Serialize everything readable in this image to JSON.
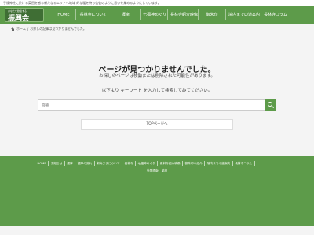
{
  "topbar": {
    "text": "子规神社に於ける菜田を感る新たなるエリアへ地域 的な暖を持ち信徒のように思いを集めるようにしています。"
  },
  "header": {
    "logo_sub": "あなたを歓迎する",
    "logo_main": "振興会"
  },
  "nav": [
    "HOME",
    "長林寺について",
    "護摩",
    "七福神めぐり",
    "長林寺紹介映像",
    "御朱印",
    "境内までの道案内",
    "長林寺コラム"
  ],
  "breadcrumb": {
    "home": "ホーム",
    "current": "お探しの記事は見つかりませんでした。"
  },
  "notfound": {
    "title": "ページが見つかりませんでした。",
    "message": "お探しのページは移動または削除された可能性があります。",
    "hint": "以下より キーワード を入力して検索してみてください。"
  },
  "search": {
    "placeholder": "検索"
  },
  "top_link": "TOPページへ",
  "footer": {
    "nav": [
      "HOME",
      "お知らせ",
      "護摩",
      "護摩の流れ",
      "和尚さまについて",
      "長林寺",
      "七福神めぐり",
      "長林寺紹介映像",
      "御朱印の紹介",
      "境内までの道案内",
      "長林寺コラム"
    ],
    "sub": [
      "外国語版",
      "英語"
    ]
  },
  "colors": {
    "brand_green": "#5d9b4a",
    "dark_green": "#3f6e34",
    "background": "#f4f4f4"
  }
}
